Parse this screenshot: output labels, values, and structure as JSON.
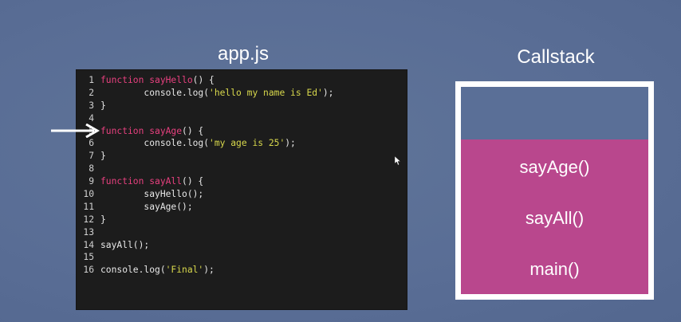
{
  "code_panel": {
    "title": "app.js",
    "lines": [
      {
        "n": "1",
        "parts": [
          {
            "t": "function ",
            "c": "kw"
          },
          {
            "t": "sayHello",
            "c": "fn"
          },
          {
            "t": "() {",
            "c": "plain"
          }
        ]
      },
      {
        "n": "2",
        "parts": [
          {
            "t": "        console.log(",
            "c": "plain"
          },
          {
            "t": "'hello my name is Ed'",
            "c": "str"
          },
          {
            "t": ");",
            "c": "plain"
          }
        ]
      },
      {
        "n": "3",
        "parts": [
          {
            "t": "}",
            "c": "plain"
          }
        ]
      },
      {
        "n": "4",
        "parts": []
      },
      {
        "n": "5",
        "parts": [
          {
            "t": "function ",
            "c": "kw"
          },
          {
            "t": "sayAge",
            "c": "fn"
          },
          {
            "t": "() {",
            "c": "plain"
          }
        ]
      },
      {
        "n": "6",
        "parts": [
          {
            "t": "        console.log(",
            "c": "plain"
          },
          {
            "t": "'my age is 25'",
            "c": "str"
          },
          {
            "t": ");",
            "c": "plain"
          }
        ]
      },
      {
        "n": "7",
        "parts": [
          {
            "t": "}",
            "c": "plain"
          }
        ]
      },
      {
        "n": "8",
        "parts": []
      },
      {
        "n": "9",
        "parts": [
          {
            "t": "function ",
            "c": "kw"
          },
          {
            "t": "sayAll",
            "c": "fn"
          },
          {
            "t": "() {",
            "c": "plain"
          }
        ]
      },
      {
        "n": "10",
        "parts": [
          {
            "t": "        sayHello();",
            "c": "plain"
          }
        ]
      },
      {
        "n": "11",
        "parts": [
          {
            "t": "        sayAge();",
            "c": "plain"
          }
        ]
      },
      {
        "n": "12",
        "parts": [
          {
            "t": "}",
            "c": "plain"
          }
        ]
      },
      {
        "n": "13",
        "parts": []
      },
      {
        "n": "14",
        "parts": [
          {
            "t": "sayAll();",
            "c": "plain"
          }
        ]
      },
      {
        "n": "15",
        "parts": []
      },
      {
        "n": "16",
        "parts": [
          {
            "t": "console.log(",
            "c": "plain"
          },
          {
            "t": "'Final'",
            "c": "str"
          },
          {
            "t": ");",
            "c": "plain"
          }
        ]
      }
    ]
  },
  "callstack": {
    "title": "Callstack",
    "frames": [
      "sayAge()",
      "sayAll()",
      "main()"
    ]
  },
  "pointer": {
    "icon": "right-arrow-icon",
    "line": 5
  },
  "colors": {
    "background": "#5a6f97",
    "editor": "#1c1c1c",
    "keyword": "#e8407f",
    "string": "#d8d84c",
    "stack_fill": "#b9478d",
    "stack_border": "#ffffff"
  }
}
